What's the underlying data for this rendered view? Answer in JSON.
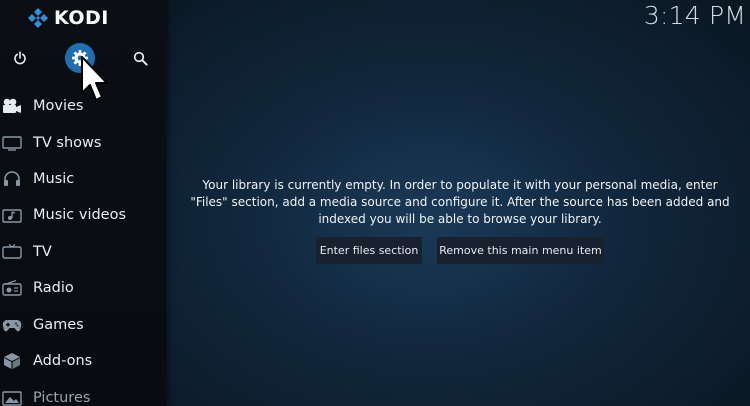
{
  "app": {
    "logo_text": "KODI"
  },
  "header": {
    "clock": "3:14 PM"
  },
  "top_buttons": [
    {
      "name": "power",
      "icon": "power-icon"
    },
    {
      "name": "settings",
      "icon": "gear-icon"
    },
    {
      "name": "search",
      "icon": "search-icon"
    }
  ],
  "sidebar": {
    "items": [
      {
        "label": "Movies",
        "icon": "movie-camera-icon"
      },
      {
        "label": "TV shows",
        "icon": "monitor-icon"
      },
      {
        "label": "Music",
        "icon": "headphones-icon"
      },
      {
        "label": "Music videos",
        "icon": "music-video-icon"
      },
      {
        "label": "TV",
        "icon": "tv-icon"
      },
      {
        "label": "Radio",
        "icon": "radio-icon"
      },
      {
        "label": "Games",
        "icon": "gamepad-icon"
      },
      {
        "label": "Add-ons",
        "icon": "box-icon"
      },
      {
        "label": "Pictures",
        "icon": "picture-icon"
      }
    ]
  },
  "main": {
    "message": "Your library is currently empty. In order to populate it with your personal media, enter \"Files\" section, add a media source and configure it. After the source has been added and indexed you will be able to browse your library.",
    "buttons": {
      "enter_files": "Enter files section",
      "remove_item": "Remove this main menu item"
    }
  },
  "colors": {
    "accent": "#1f6fb0",
    "sidebar_bg": "#0b0f14",
    "main_bg": "#11273d",
    "button_bg": "#17222e",
    "logo_blue": "#2f8fd8"
  }
}
